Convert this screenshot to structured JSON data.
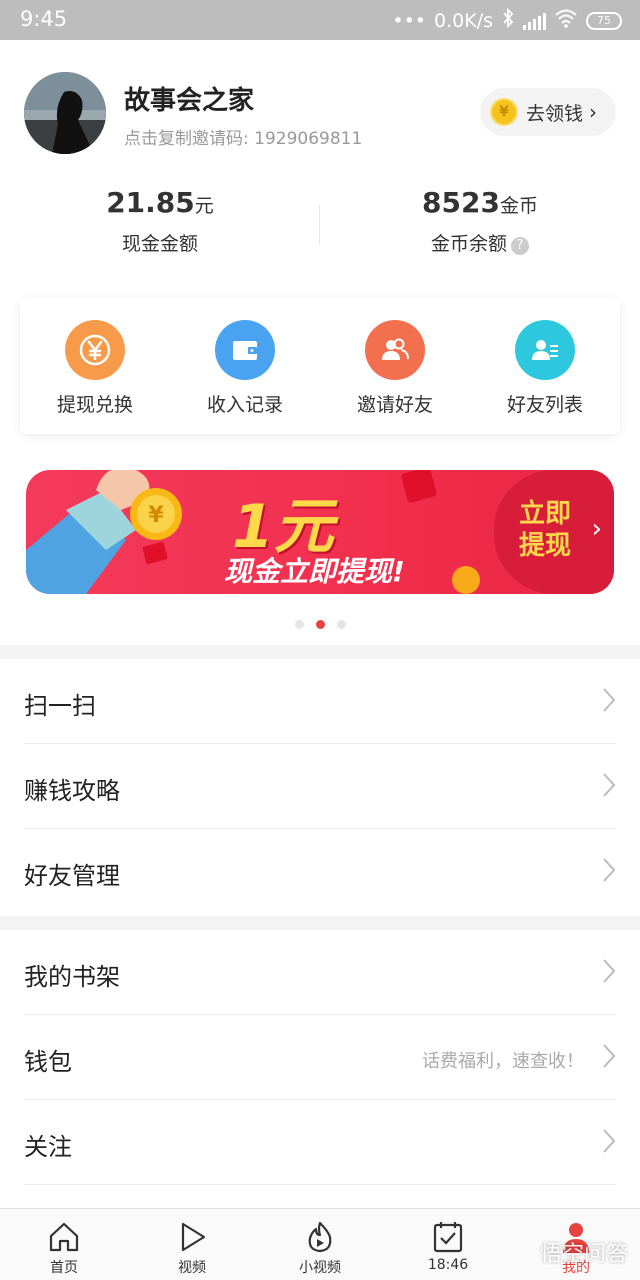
{
  "status_bar": {
    "time": "9:45",
    "dots": "•••",
    "speed": "0.0K/s",
    "battery": "75"
  },
  "profile": {
    "name": "故事会之家",
    "invite_code": "点击复制邀请码: 1929069811",
    "get_money_label": "去领钱"
  },
  "balances": {
    "cash_value": "21.85",
    "cash_unit": "元",
    "cash_label": "现金金额",
    "coin_value": "8523",
    "coin_unit": "金币",
    "coin_label": "金币余额"
  },
  "actions": [
    {
      "label": "提现兑换",
      "icon": "yen-icon",
      "color": "#f79a4a"
    },
    {
      "label": "收入记录",
      "icon": "wallet-icon",
      "color": "#4aa3f0"
    },
    {
      "label": "邀请好友",
      "icon": "friends-icon",
      "color": "#f2704e"
    },
    {
      "label": "好友列表",
      "icon": "contact-list-icon",
      "color": "#2dc8de"
    }
  ],
  "banner": {
    "big": "1元",
    "sub": "现金立即提现!",
    "button": "立即提现"
  },
  "menu_group_1": [
    {
      "label": "扫一扫"
    },
    {
      "label": "赚钱攻略"
    },
    {
      "label": "好友管理"
    }
  ],
  "menu_group_2": [
    {
      "label": "我的书架",
      "hint": ""
    },
    {
      "label": "钱包",
      "hint": "话费福利，速查收！"
    },
    {
      "label": "关注",
      "hint": ""
    }
  ],
  "nav": [
    {
      "label": "首页",
      "icon": "home-icon"
    },
    {
      "label": "视频",
      "icon": "play-icon"
    },
    {
      "label": "小视频",
      "icon": "flame-play-icon"
    },
    {
      "label": "18:46",
      "icon": "task-check-icon"
    },
    {
      "label": "我的",
      "icon": "profile-icon"
    }
  ],
  "watermark": "悟空问答",
  "colors": {
    "accent": "#e64340",
    "banner_yellow": "#ffd94a"
  }
}
